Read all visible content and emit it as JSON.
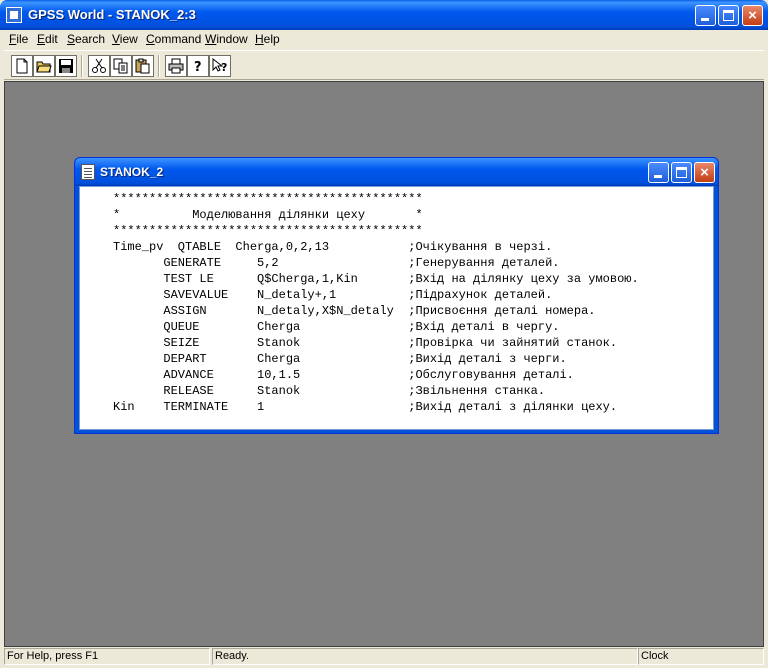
{
  "app": {
    "title": "GPSS World - STANOK_2:3"
  },
  "menu": [
    {
      "u": "F",
      "rest": "ile"
    },
    {
      "u": "E",
      "rest": "dit"
    },
    {
      "u": "S",
      "rest": "earch"
    },
    {
      "u": "V",
      "rest": "iew"
    },
    {
      "u": "C",
      "rest": "ommand"
    },
    {
      "u": "W",
      "rest": "indow"
    },
    {
      "u": "H",
      "rest": "elp"
    }
  ],
  "toolbar": {
    "icons": [
      "new-file-icon",
      "open-folder-icon",
      "save-icon",
      "cut-icon",
      "copy-icon",
      "paste-icon",
      "print-icon",
      "help-icon",
      "context-help-icon"
    ]
  },
  "child": {
    "title": "STANOK_2",
    "lines": [
      "*******************************************",
      "*          Моделювання ділянки цеху       *",
      "*******************************************",
      "Time_pv  QTABLE  Cherga,0,2,13           ;Очікування в черзі.",
      "       GENERATE     5,2                  ;Генерування деталей.",
      "       TEST LE      Q$Cherga,1,Kin       ;Вхід на ділянку цеху за умовою.",
      "       SAVEVALUE    N_detaly+,1          ;Підрахунок деталей.",
      "       ASSIGN       N_detaly,X$N_detaly  ;Присвоєння деталі номера.",
      "       QUEUE        Cherga               ;Вхід деталі в чергу.",
      "       SEIZE        Stanok               ;Провірка чи зайнятий станок.",
      "       DEPART       Cherga               ;Вихід деталі з черги.",
      "       ADVANCE      10,1.5               ;Обслуговування деталі.",
      "       RELEASE      Stanok               ;Звільнення станка.",
      "Kin    TERMINATE    1                    ;Вихід деталі з ділянки цеху."
    ]
  },
  "status": {
    "help": "For Help, press F1",
    "state": "Ready.",
    "clock": "Clock"
  },
  "colors": {
    "titlebar": "#0054E3",
    "mdi_background": "#808080",
    "chrome": "#ECE9D8"
  }
}
